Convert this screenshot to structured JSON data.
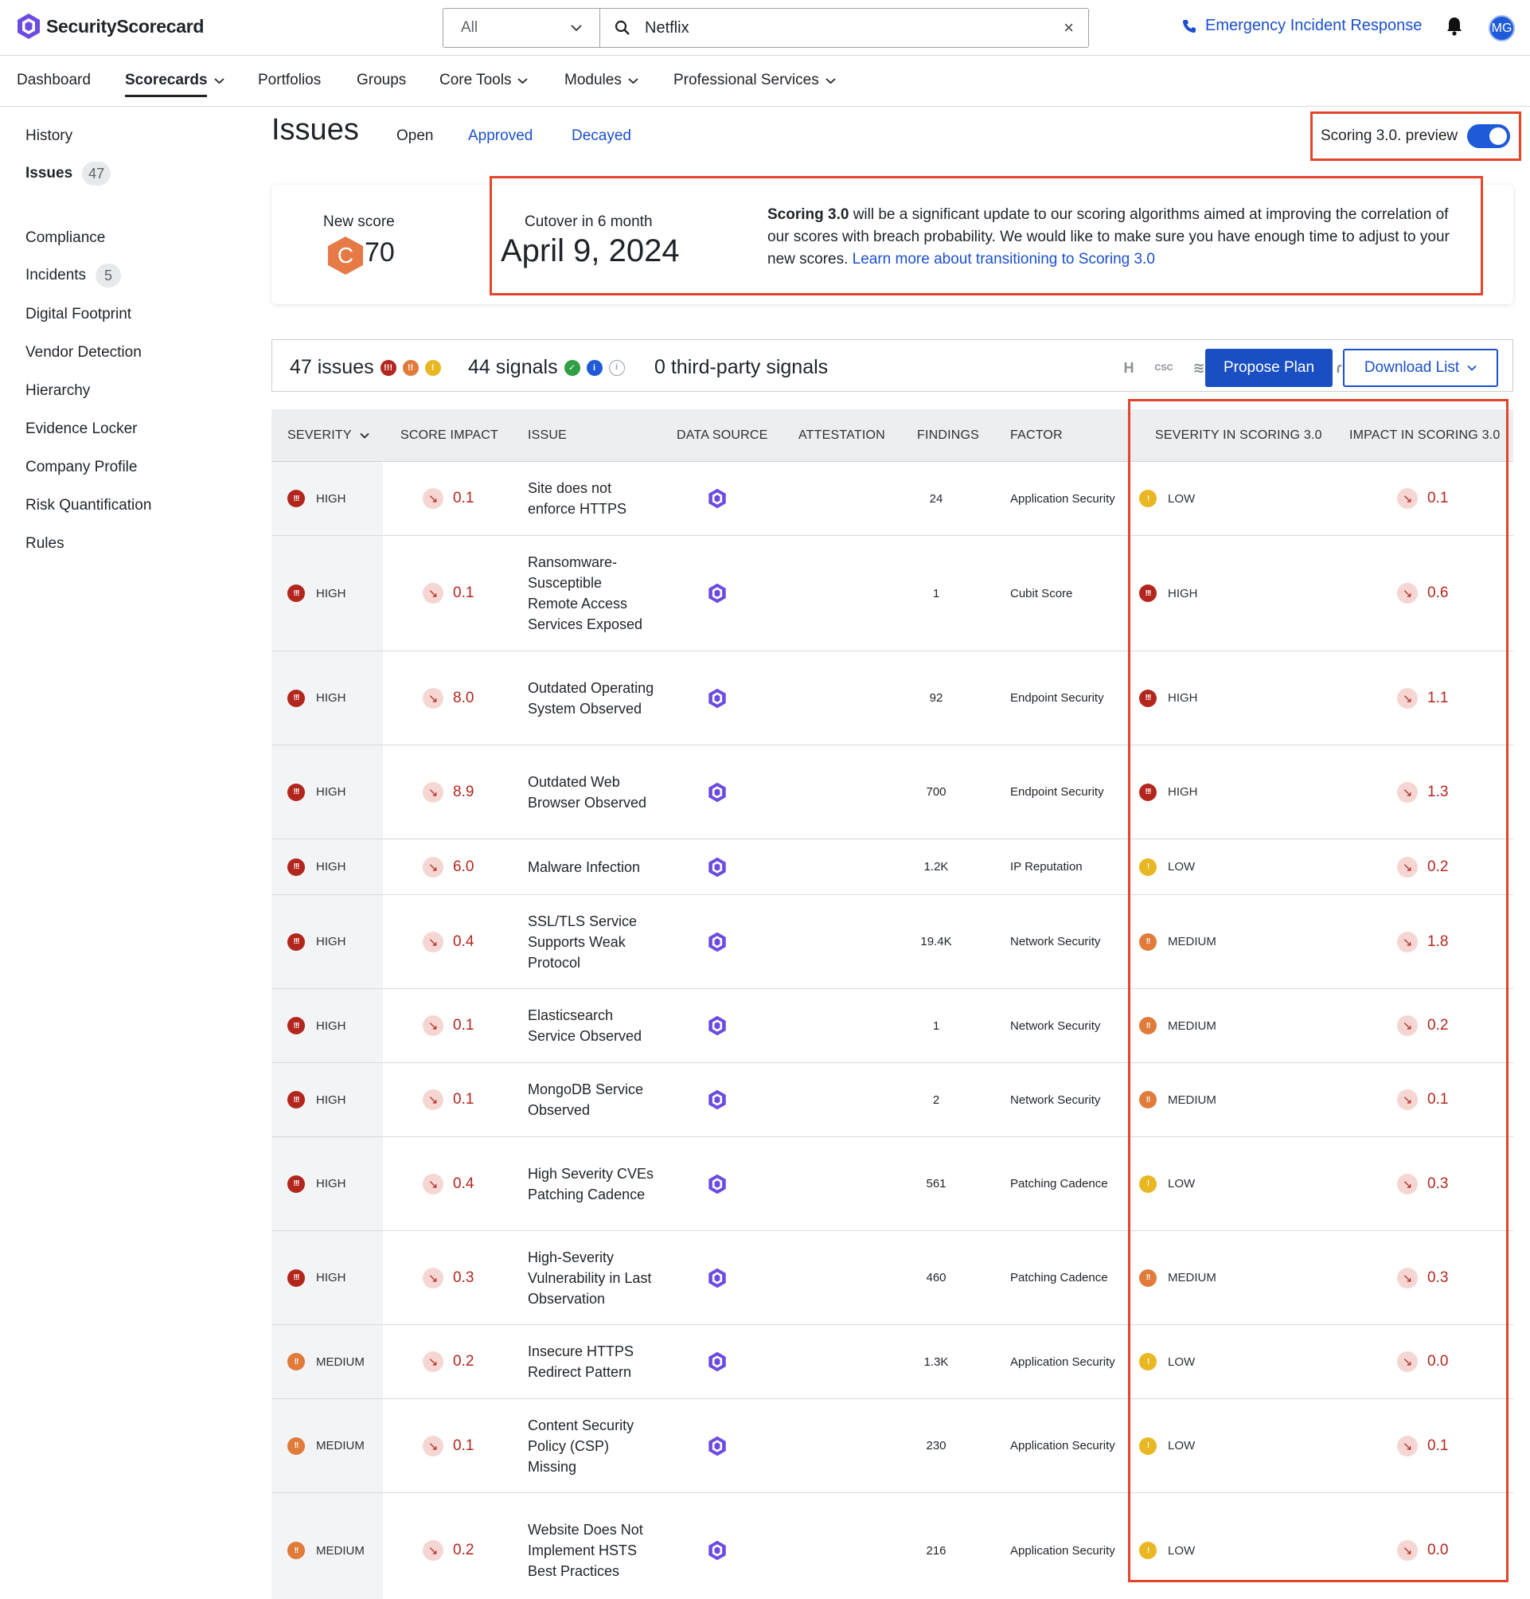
{
  "app": {
    "logo_text": "SecurityScorecard",
    "search": {
      "scope": "All",
      "value": "Netflix"
    },
    "emergency": "Emergency Incident Response",
    "avatar": "MG"
  },
  "nav": [
    {
      "label": "Dashboard",
      "dropdown": false,
      "active": false
    },
    {
      "label": "Scorecards",
      "dropdown": true,
      "active": true
    },
    {
      "label": "Portfolios",
      "dropdown": false,
      "active": false
    },
    {
      "label": "Groups",
      "dropdown": false,
      "active": false
    },
    {
      "label": "Core Tools",
      "dropdown": true,
      "active": false
    },
    {
      "label": "Modules",
      "dropdown": true,
      "active": false
    },
    {
      "label": "Professional Services",
      "dropdown": true,
      "active": false
    }
  ],
  "sidebar": [
    {
      "label": "History",
      "count": null,
      "active": false
    },
    {
      "label": "Issues",
      "count": "47",
      "active": true
    },
    {
      "label": "Compliance",
      "count": null,
      "active": false
    },
    {
      "label": "Incidents",
      "count": "5",
      "active": false
    },
    {
      "label": "Digital Footprint",
      "count": null,
      "active": false
    },
    {
      "label": "Vendor Detection",
      "count": null,
      "active": false
    },
    {
      "label": "Hierarchy",
      "count": null,
      "active": false
    },
    {
      "label": "Evidence Locker",
      "count": null,
      "active": false
    },
    {
      "label": "Company Profile",
      "count": null,
      "active": false
    },
    {
      "label": "Risk Quantification",
      "count": null,
      "active": false
    },
    {
      "label": "Rules",
      "count": null,
      "active": false
    }
  ],
  "header": {
    "title": "Issues",
    "tabs": [
      "Open",
      "Approved",
      "Decayed"
    ],
    "preview_label": "Scoring 3.0. preview",
    "preview_on": true
  },
  "score_card": {
    "new_score_label": "New score",
    "grade": "C",
    "score": "70",
    "cutover_label": "Cutover in 6 month",
    "cutover_date": "April 9, 2024",
    "desc_bold": "Scoring 3.0",
    "desc_text": " will be a significant update to our scoring algorithms aimed at improving the correlation of our scores with breach probability. We would like to make sure you have enough time to adjust to your new scores. ",
    "desc_link": "Learn more about transitioning to Scoring 3.0"
  },
  "summary": {
    "issues": "47 issues",
    "signals": "44 signals",
    "third_party": "0 third-party signals",
    "propose_plan": "Propose Plan",
    "download_list": "Download List"
  },
  "table": {
    "columns": [
      "SEVERITY",
      "SCORE IMPACT",
      "ISSUE",
      "DATA SOURCE",
      "ATTESTATION",
      "FINDINGS",
      "FACTOR",
      "SEVERITY IN SCORING 3.0",
      "IMPACT IN SCORING 3.0"
    ],
    "rows": [
      {
        "severity": "HIGH",
        "impact": "0.1",
        "issue": "Site does not enforce HTTPS",
        "findings": "24",
        "factor": "Application Security",
        "sev3": "LOW",
        "impact3": "0.1"
      },
      {
        "severity": "HIGH",
        "impact": "0.1",
        "issue": "Ransomware-Susceptible Remote Access Services Exposed",
        "findings": "1",
        "factor": "Cubit Score",
        "sev3": "HIGH",
        "impact3": "0.6"
      },
      {
        "severity": "HIGH",
        "impact": "8.0",
        "issue": "Outdated Operating System Observed",
        "findings": "92",
        "factor": "Endpoint Security",
        "sev3": "HIGH",
        "impact3": "1.1"
      },
      {
        "severity": "HIGH",
        "impact": "8.9",
        "issue": "Outdated Web Browser Observed",
        "findings": "700",
        "factor": "Endpoint Security",
        "sev3": "HIGH",
        "impact3": "1.3"
      },
      {
        "severity": "HIGH",
        "impact": "6.0",
        "issue": "Malware Infection",
        "findings": "1.2K",
        "factor": "IP Reputation",
        "sev3": "LOW",
        "impact3": "0.2"
      },
      {
        "severity": "HIGH",
        "impact": "0.4",
        "issue": "SSL/TLS Service Supports Weak Protocol",
        "findings": "19.4K",
        "factor": "Network Security",
        "sev3": "MEDIUM",
        "impact3": "1.8"
      },
      {
        "severity": "HIGH",
        "impact": "0.1",
        "issue": "Elasticsearch Service Observed",
        "findings": "1",
        "factor": "Network Security",
        "sev3": "MEDIUM",
        "impact3": "0.2"
      },
      {
        "severity": "HIGH",
        "impact": "0.1",
        "issue": "MongoDB Service Observed",
        "findings": "2",
        "factor": "Network Security",
        "sev3": "MEDIUM",
        "impact3": "0.1"
      },
      {
        "severity": "HIGH",
        "impact": "0.4",
        "issue": "High Severity CVEs Patching Cadence",
        "findings": "561",
        "factor": "Patching Cadence",
        "sev3": "LOW",
        "impact3": "0.3"
      },
      {
        "severity": "HIGH",
        "impact": "0.3",
        "issue": "High-Severity Vulnerability in Last Observation",
        "findings": "460",
        "factor": "Patching Cadence",
        "sev3": "MEDIUM",
        "impact3": "0.3"
      },
      {
        "severity": "MEDIUM",
        "impact": "0.2",
        "issue": "Insecure HTTPS Redirect Pattern",
        "findings": "1.3K",
        "factor": "Application Security",
        "sev3": "LOW",
        "impact3": "0.0"
      },
      {
        "severity": "MEDIUM",
        "impact": "0.1",
        "issue": "Content Security Policy (CSP) Missing",
        "findings": "230",
        "factor": "Application Security",
        "sev3": "LOW",
        "impact3": "0.1"
      },
      {
        "severity": "MEDIUM",
        "impact": "0.2",
        "issue": "Website Does Not Implement HSTS Best Practices",
        "findings": "216",
        "factor": "Application Security",
        "sev3": "LOW",
        "impact3": "0.0"
      }
    ]
  },
  "colors": {
    "accent": "#1a4fc4",
    "highlight": "#e2452c",
    "high": "#b3261e",
    "medium": "#e07b39",
    "low": "#e8b721"
  }
}
